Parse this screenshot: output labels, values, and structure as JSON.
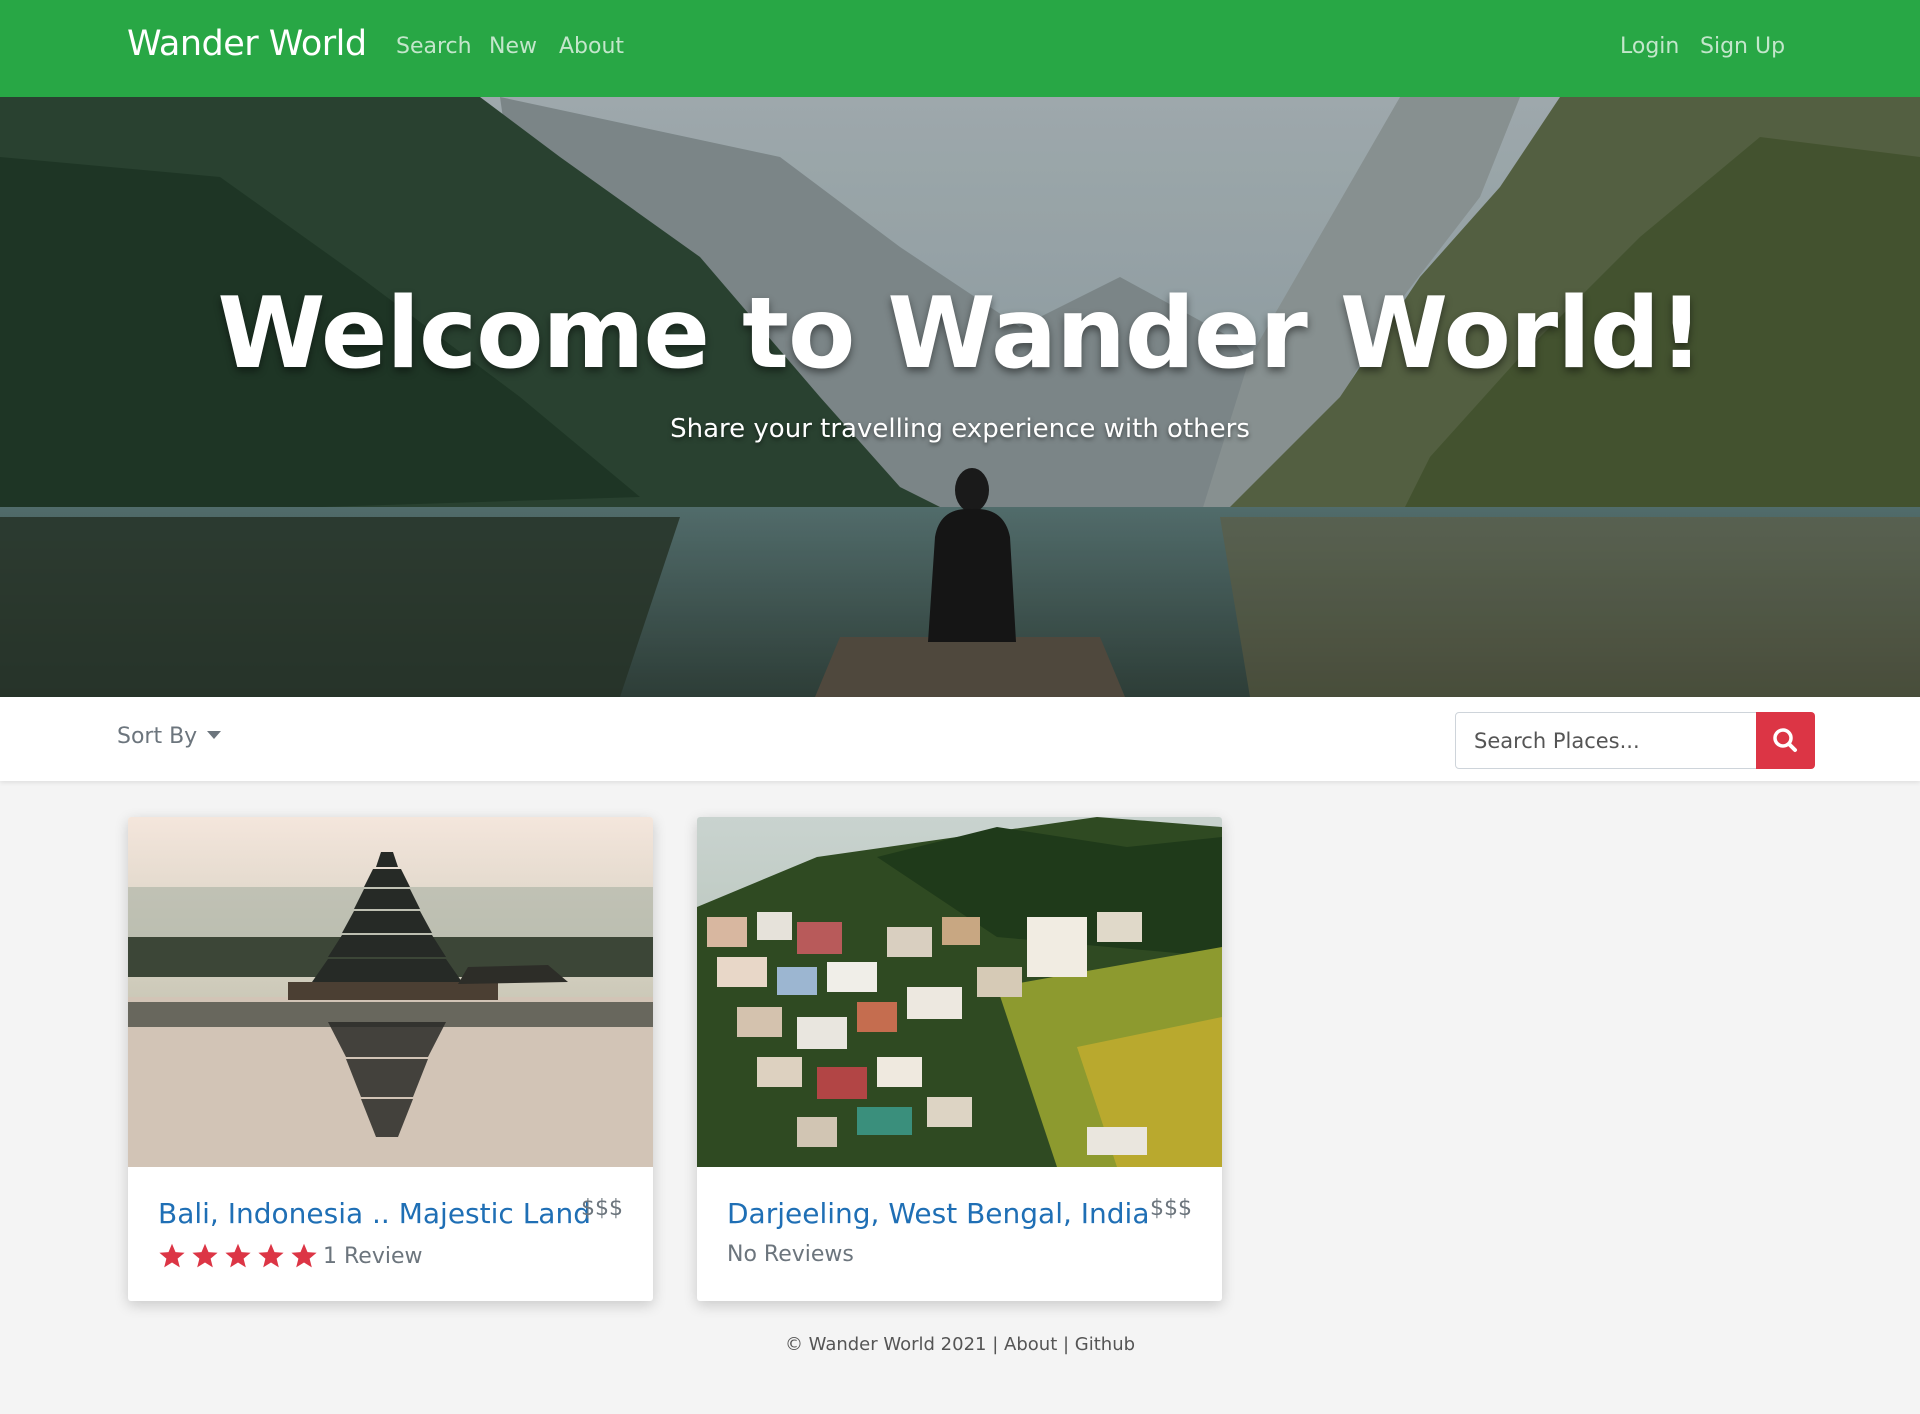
{
  "navbar": {
    "brand": "Wander World",
    "links": [
      "Search",
      "New",
      "About"
    ],
    "right_links": [
      "Login",
      "Sign Up"
    ],
    "bg_color": "#28a745"
  },
  "hero": {
    "title": "Welcome to Wander World!",
    "subtitle": "Share your travelling experience with others"
  },
  "toolbar": {
    "sort_label": "Sort By",
    "search_placeholder": "Search Places...",
    "search_icon": "search-icon",
    "search_button_color": "#dc3545"
  },
  "cards": [
    {
      "title": "Bali, Indonesia .. Majestic Land",
      "price": "$$$",
      "rating": 5,
      "reviews_label": "1 Review",
      "image": "temple-lake-photo"
    },
    {
      "title": "Darjeeling, West Bengal, India",
      "price": "$$$",
      "reviews_label": "No Reviews",
      "image": "hillside-town-photo"
    }
  ],
  "footer": {
    "copyright": "© Wander World 2021",
    "about": "About",
    "github": "Github"
  }
}
